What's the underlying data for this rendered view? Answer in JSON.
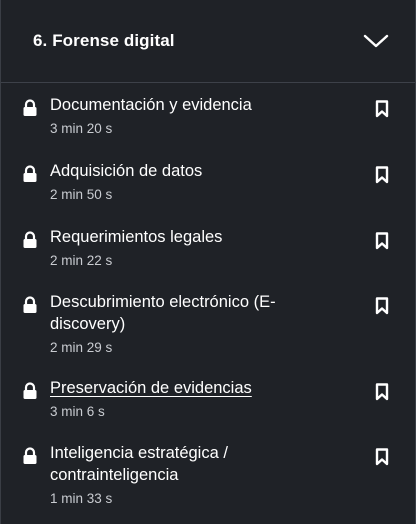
{
  "section": {
    "title": "6. Forense digital",
    "expanded": true
  },
  "items": [
    {
      "title": "Documentación y evidencia",
      "duration": "3 min 20 s",
      "locked": true,
      "active": false
    },
    {
      "title": "Adquisición de datos",
      "duration": "2 min 50 s",
      "locked": true,
      "active": false
    },
    {
      "title": "Requerimientos legales",
      "duration": "2 min 22 s",
      "locked": true,
      "active": false
    },
    {
      "title": "Descubrimiento electrónico (E-discovery)",
      "duration": "2 min 29 s",
      "locked": true,
      "active": false
    },
    {
      "title": "Preservación de evidencias",
      "duration": "3 min 6 s",
      "locked": true,
      "active": true
    },
    {
      "title": "Inteligencia estratégica / contrainteligencia",
      "duration": "1 min 33 s",
      "locked": true,
      "active": false
    }
  ],
  "icons": {
    "lock": "lock-icon",
    "bookmark": "bookmark-icon",
    "chevron": "chevron-down-icon"
  },
  "colors": {
    "background": "#1f2227",
    "text": "#ffffff",
    "muted": "#c9ccd1",
    "divider": "#3d4149"
  }
}
